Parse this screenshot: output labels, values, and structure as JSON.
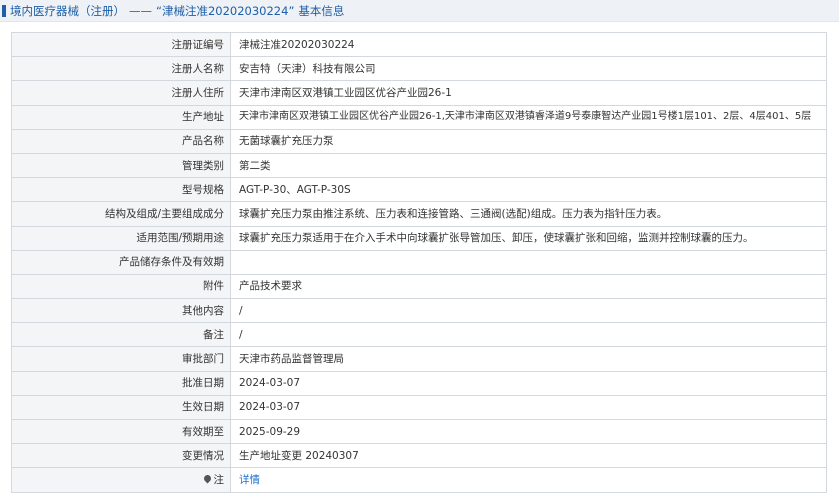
{
  "header": {
    "category": "境内医疗器械（注册）",
    "separator": "——",
    "subject": "“津械注准20202030224”",
    "suffix": "基本信息"
  },
  "rows": [
    {
      "label": "注册证编号",
      "value": "津械注准20202030224"
    },
    {
      "label": "注册人名称",
      "value": "安吉特（天津）科技有限公司"
    },
    {
      "label": "注册人住所",
      "value": "天津市津南区双港镇工业园区优谷产业园26-1"
    },
    {
      "label": "生产地址",
      "value": "天津市津南区双港镇工业园区优谷产业园26-1,天津市津南区双港镇睿泽道9号泰康智达产业园1号楼1层101、2层、4层401、5层"
    },
    {
      "label": "产品名称",
      "value": "无菌球囊扩充压力泵"
    },
    {
      "label": "管理类别",
      "value": "第二类"
    },
    {
      "label": "型号规格",
      "value": "AGT-P-30、AGT-P-30S"
    },
    {
      "label": "结构及组成/主要组成成分",
      "value": "球囊扩充压力泵由推注系统、压力表和连接管路、三通阀(选配)组成。压力表为指针压力表。"
    },
    {
      "label": "适用范围/预期用途",
      "value": "球囊扩充压力泵适用于在介入手术中向球囊扩张导管加压、卸压，使球囊扩张和回缩，监测并控制球囊的压力。"
    },
    {
      "label": "产品储存条件及有效期",
      "value": ""
    },
    {
      "label": "附件",
      "value": "产品技术要求"
    },
    {
      "label": "其他内容",
      "value": "/"
    },
    {
      "label": "备注",
      "value": "/"
    },
    {
      "label": "审批部门",
      "value": "天津市药品监督管理局"
    },
    {
      "label": "批准日期",
      "value": "2024-03-07"
    },
    {
      "label": "生效日期",
      "value": "2024-03-07"
    },
    {
      "label": "有效期至",
      "value": "2025-09-29"
    },
    {
      "label": "变更情况",
      "value": "生产地址变更 20240307"
    }
  ],
  "note_row": {
    "icon": "pin-icon",
    "label": "注",
    "link": "详情"
  },
  "colors": {
    "accent": "#1e5fa8",
    "link": "#1e6fd0",
    "label_bg": "#f4f5f7",
    "border": "#d3d8de"
  }
}
